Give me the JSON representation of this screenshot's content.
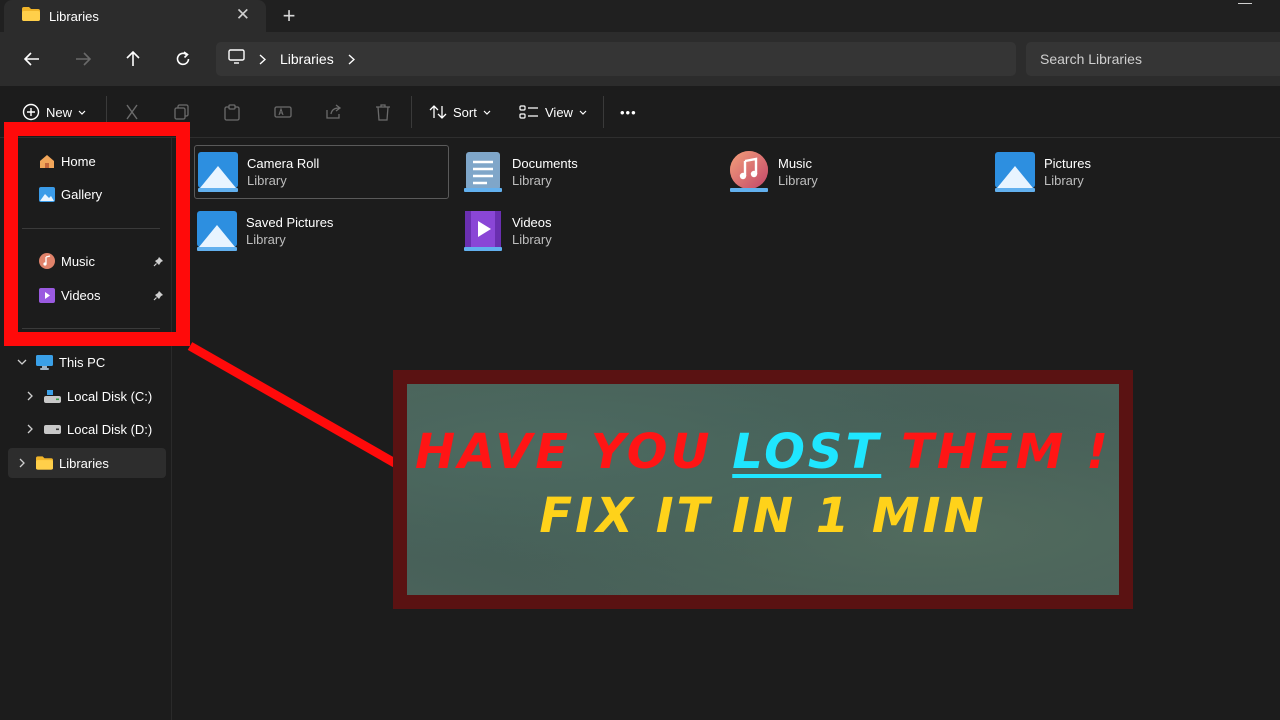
{
  "window": {
    "tab_title": "Libraries",
    "new_tab_symbol": "+",
    "close_symbol": "✕"
  },
  "address": {
    "breadcrumb": [
      "Libraries"
    ],
    "search_placeholder": "Search Libraries"
  },
  "toolbar": {
    "new_label": "New",
    "sort_label": "Sort",
    "view_label": "View",
    "more_label": "•••"
  },
  "sidebar": {
    "quick": [
      {
        "label": "Home",
        "icon": "home-icon"
      },
      {
        "label": "Gallery",
        "icon": "gallery-icon"
      }
    ],
    "pinned": [
      {
        "label": "Music",
        "icon": "music-icon",
        "pinned": true
      },
      {
        "label": "Videos",
        "icon": "videos-icon",
        "pinned": true
      }
    ],
    "tree": [
      {
        "label": "This PC",
        "icon": "this-pc-icon",
        "expanded": true
      },
      {
        "label": "Local Disk (C:)",
        "icon": "drive-c-icon"
      },
      {
        "label": "Local Disk (D:)",
        "icon": "drive-d-icon"
      },
      {
        "label": "Libraries",
        "icon": "folder-icon",
        "selected": true
      }
    ]
  },
  "libraries": [
    {
      "name": "Camera Roll",
      "type": "Library",
      "icon": "pictures-library-icon"
    },
    {
      "name": "Documents",
      "type": "Library",
      "icon": "documents-library-icon"
    },
    {
      "name": "Music",
      "type": "Library",
      "icon": "music-library-icon"
    },
    {
      "name": "Pictures",
      "type": "Library",
      "icon": "pictures-library-icon"
    },
    {
      "name": "Saved Pictures",
      "type": "Library",
      "icon": "pictures-library-icon"
    },
    {
      "name": "Videos",
      "type": "Library",
      "icon": "videos-library-icon"
    }
  ],
  "overlay": {
    "line1_a": "HAVE YOU ",
    "line1_lost": "LOST",
    "line1_b": " THEM !",
    "line2": "FIX IT IN 1 MIN"
  },
  "colors": {
    "highlight_box": "#ff0a0a",
    "banner_red": "#ff1515",
    "banner_cyan": "#1fe6ff",
    "banner_yellow": "#ffd21a"
  }
}
